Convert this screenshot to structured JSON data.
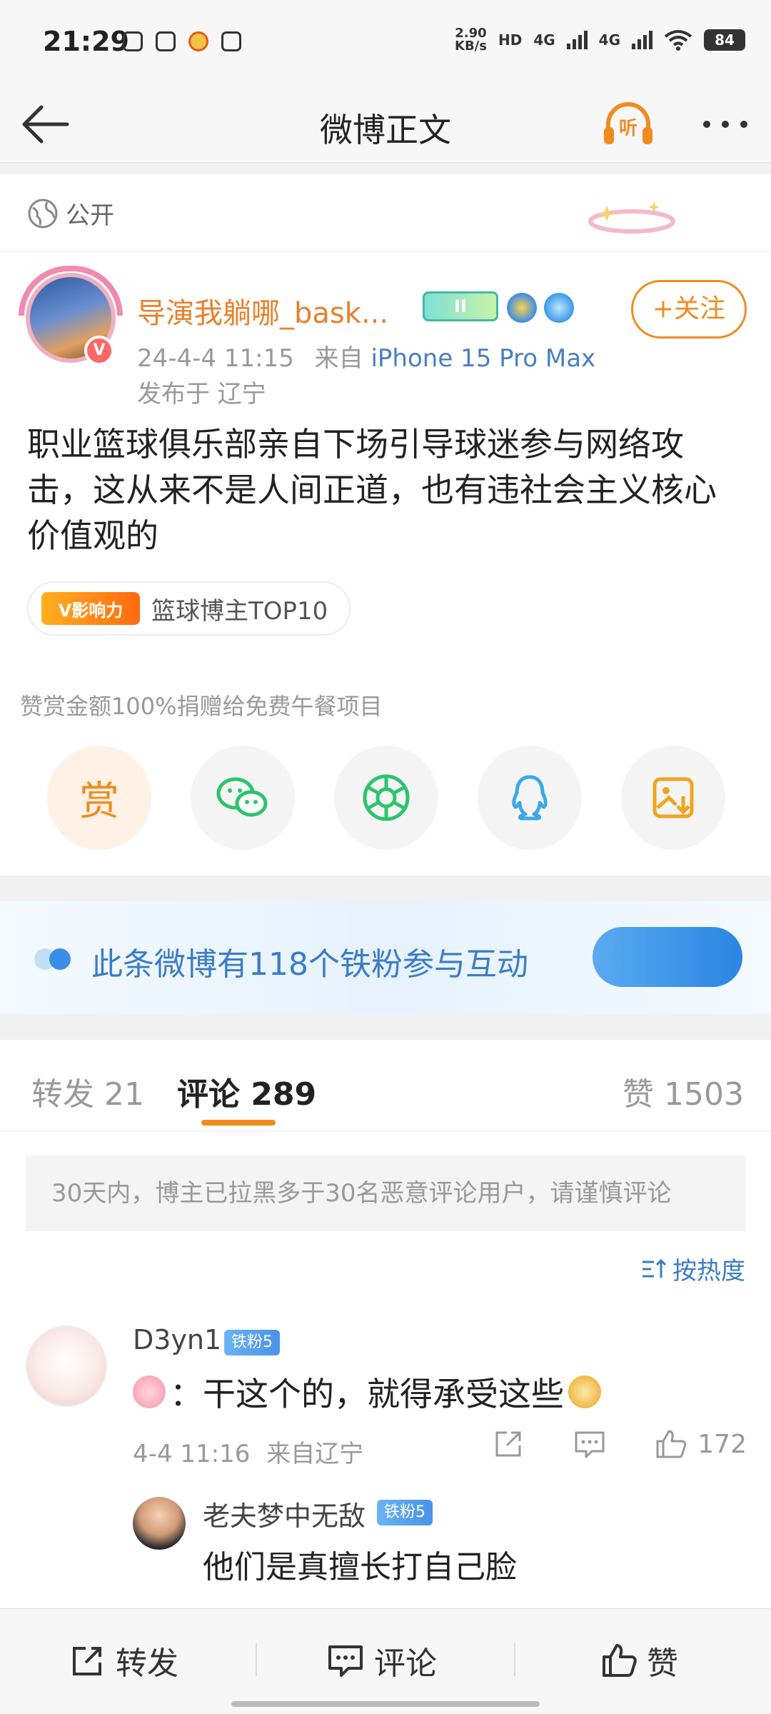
{
  "status_bar": {
    "time": "21:29",
    "net_speed_value": "2.90",
    "net_speed_unit": "KB/s",
    "hd_tag": "HD",
    "signal_1": "4G",
    "signal_2": "4G",
    "battery": "84"
  },
  "nav": {
    "title": "微博正文",
    "listen_label": "听"
  },
  "post": {
    "visibility": "公开",
    "author_name": "导演我躺哪_bask...",
    "level_badge": "II",
    "verify_mark": "V",
    "timestamp": "24-4-4 11:15",
    "source_prefix": "来自",
    "source_device": "iPhone 15 Pro Max",
    "location": "发布于 辽宁",
    "follow_label": "+关注",
    "text": "职业篮球俱乐部亲自下场引导球迷参与网络攻击，这从来不是人间正道，也有违社会主义核心价值观的",
    "influence_badge": "V影响力",
    "influence_label": "篮球博主TOP10",
    "reward_note": "赞赏金额100%捐赠给免费午餐项目",
    "reward_label": "赏",
    "share_icons": [
      "wechat-icon",
      "moments-icon",
      "qq-icon",
      "save-image-icon"
    ]
  },
  "fans_bar": {
    "text": "此条微博有118个铁粉参与互动"
  },
  "comments": {
    "tabs": {
      "repost": "转发 21",
      "comment": "评论 289",
      "like": "赞 1503"
    },
    "notice": "30天内，博主已拉黑多于30名恶意评论用户，请谨慎评论",
    "sort_label": "按热度",
    "items": [
      {
        "user": "D3yn1",
        "badge": "铁粉5",
        "text": "：干这个的，就得承受这些",
        "time": "4-4 11:16",
        "location": "来自辽宁",
        "likes": "172",
        "reply": {
          "user": "老夫梦中无敌",
          "badge": "铁粉5",
          "text": "他们是真擅长打自己脸"
        }
      }
    ]
  },
  "bottom_bar": {
    "repost": "转发",
    "comment": "评论",
    "like": "赞"
  },
  "colors": {
    "accent_orange": "#f08c1e",
    "link_blue": "#3b7cc6",
    "author_orange": "#e8812a"
  }
}
